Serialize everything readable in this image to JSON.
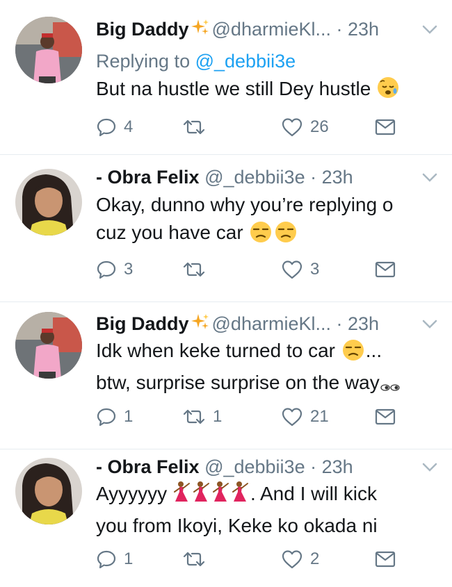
{
  "tweets": [
    {
      "name": "Big Daddy",
      "handle": "@dharmieKl...",
      "dot": "·",
      "time": "23h",
      "verified_emoji": true,
      "replying_prefix": "Replying to ",
      "replying_handle": "@_debbii3e",
      "text_lines": [
        "But na hustle we still Dey hustle"
      ],
      "reply_count": "4",
      "retweet_count": "",
      "like_count": "26"
    },
    {
      "name": "- Obra Felix",
      "handle": "@_debbii3e",
      "dot": "·",
      "time": "23h",
      "text_lines": [
        "Okay, dunno why you’re replying o",
        "cuz you have car"
      ],
      "reply_count": "3",
      "retweet_count": "",
      "like_count": "3"
    },
    {
      "name": "Big Daddy",
      "handle": "@dharmieKl...",
      "dot": "·",
      "time": "23h",
      "text_lines": [
        "Idk when keke turned to car",
        "...",
        "btw, surprise surprise on the way"
      ],
      "reply_count": "1",
      "retweet_count": "1",
      "like_count": "21"
    },
    {
      "name": "- Obra Felix",
      "handle": "@_debbii3e",
      "dot": "·",
      "time": "23h",
      "text_lines": [
        "Ayyyyyy",
        ". And I will kick",
        "you from Ikoyi, Keke ko okada ni"
      ],
      "reply_count": "1",
      "retweet_count": "",
      "like_count": "2"
    }
  ],
  "colors": {
    "name": "#14171a",
    "secondary": "#657786",
    "link": "#1da1f2",
    "thread_line": "#ccd6dd"
  },
  "icons": [
    "reply-icon",
    "retweet-icon",
    "like-icon",
    "dm-icon",
    "chevron-down-icon",
    "sparkles-icon"
  ]
}
